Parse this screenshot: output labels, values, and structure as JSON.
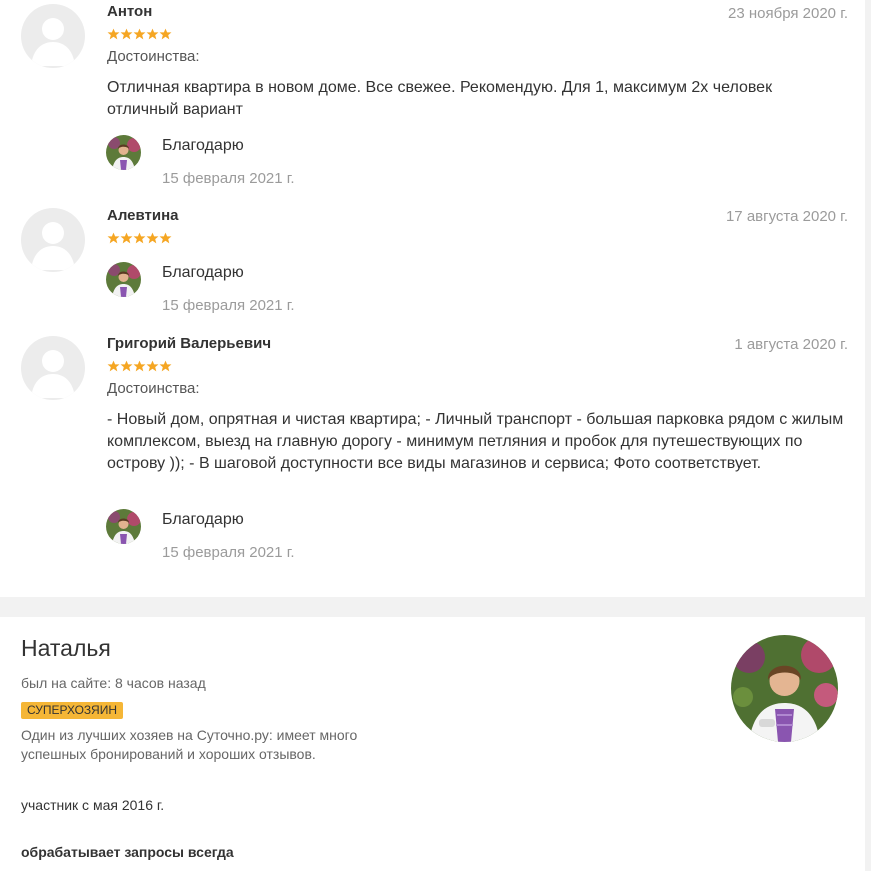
{
  "reviews": [
    {
      "author": "Антон",
      "date": "23 ноября 2020 г.",
      "rating": 5,
      "label": "Достоинства:",
      "text": "Отличная квартира в новом доме. Все свежее. Рекомендую. Для 1, максимум 2х человек отличный вариант",
      "reply": {
        "text": "Благодарю",
        "date": "15 февраля 2021 г."
      }
    },
    {
      "author": "Алевтина",
      "date": "17 августа 2020 г.",
      "rating": 5,
      "reply": {
        "text": "Благодарю",
        "date": "15 февраля 2021 г."
      }
    },
    {
      "author": "Григорий Валерьевич",
      "date": "1 августа 2020 г.",
      "rating": 5,
      "label": "Достоинства:",
      "text": "- Новый дом, опрятная и чистая квартира; - Личный транспорт - большая парковка рядом с жилым комплексом, выезд на главную дорогу - минимум петляния и пробок для путешествующих по острову )); - В шаговой доступности все виды магазинов и сервиса; Фото соответствует.",
      "reply": {
        "text": "Благодарю",
        "date": "15 февраля 2021 г."
      }
    }
  ],
  "owner": {
    "name": "Наталья",
    "last_seen": "был на сайте: 8 часов назад",
    "badge": "СУПЕРХОЗЯИН",
    "badge_desc": "Один из лучших хозяев на Суточно.ру: имеет много успешных бронирований и хороших отзывов.",
    "member_since": "участник с мая 2016 г.",
    "response": "обрабатывает запросы всегда"
  },
  "colors": {
    "star": "#f5a623",
    "badge": "#f5b636",
    "date": "#9b9b9b",
    "page_bg": "#f2f2f2"
  },
  "icons": {
    "user_placeholder": "user-silhouette-icon",
    "star": "star-icon"
  }
}
